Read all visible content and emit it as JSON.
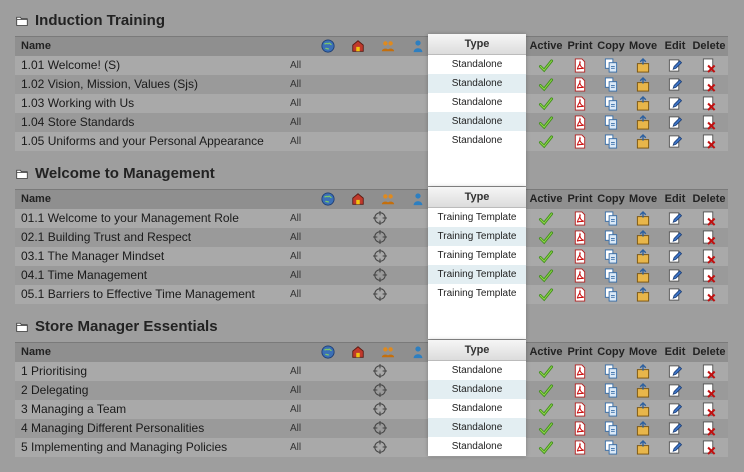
{
  "columns": {
    "name": "Name",
    "type": "Type",
    "active": "Active",
    "print": "Print",
    "copy": "Copy",
    "move": "Move",
    "edit": "Edit",
    "delete": "Delete"
  },
  "sections": [
    {
      "title": "Induction Training",
      "rows": [
        {
          "name": "1.01 Welcome! (S)",
          "scope": "All",
          "type": "Standalone"
        },
        {
          "name": "1.02 Vision, Mission, Values (Sjs)",
          "scope": "All",
          "type": "Standalone"
        },
        {
          "name": "1.03 Working with Us",
          "scope": "All",
          "type": "Standalone"
        },
        {
          "name": "1.04 Store Standards",
          "scope": "All",
          "type": "Standalone"
        },
        {
          "name": "1.05 Uniforms and your Personal Appearance",
          "scope": "All",
          "type": "Standalone"
        }
      ]
    },
    {
      "title": "Welcome to Management",
      "rows": [
        {
          "name": "01.1 Welcome to your Management Role",
          "scope": "All",
          "type": "Training Template"
        },
        {
          "name": "02.1 Building Trust and Respect",
          "scope": "All",
          "type": "Training Template"
        },
        {
          "name": "03.1 The Manager Mindset",
          "scope": "All",
          "type": "Training Template"
        },
        {
          "name": "04.1 Time Management",
          "scope": "All",
          "type": "Training Template"
        },
        {
          "name": "05.1 Barriers to Effective Time Management",
          "scope": "All",
          "type": "Training Template"
        }
      ]
    },
    {
      "title": "Store Manager Essentials",
      "rows": [
        {
          "name": "1 Prioritising",
          "scope": "All",
          "type": "Standalone"
        },
        {
          "name": "2 Delegating",
          "scope": "All",
          "type": "Standalone"
        },
        {
          "name": "3 Managing a Team",
          "scope": "All",
          "type": "Standalone"
        },
        {
          "name": "4 Managing Different Personalities",
          "scope": "All",
          "type": "Standalone"
        },
        {
          "name": "5 Implementing and Managing Policies",
          "scope": "All",
          "type": "Standalone"
        }
      ]
    }
  ],
  "icons": {
    "folder": "folder-icon",
    "globe": "globe-icon",
    "store": "store-icon",
    "group": "group-icon",
    "user": "user-icon",
    "target": "target-icon",
    "active": "checkmark-icon",
    "print": "pdf-icon",
    "copy": "copy-icon",
    "move": "move-icon",
    "edit": "edit-icon",
    "delete": "delete-icon"
  }
}
